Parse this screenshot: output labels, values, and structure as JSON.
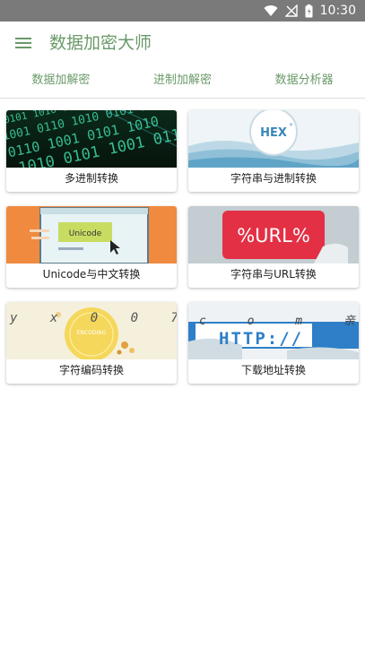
{
  "status_bar": {
    "time": "10:30"
  },
  "app": {
    "title": "数据加密大师"
  },
  "tabs": [
    {
      "label": "数据加解密"
    },
    {
      "label": "进制加解密"
    },
    {
      "label": "数据分析器"
    }
  ],
  "cards": [
    {
      "label": "多进制转换",
      "image_text": "1010 0101 1001"
    },
    {
      "label": "字符串与进制转换",
      "image_text": "HEX"
    },
    {
      "label": "Unicode与中文转换",
      "image_text": "Unicode"
    },
    {
      "label": "字符串与URL转换",
      "image_text": "%URL%"
    },
    {
      "label": "字符编码转换",
      "image_text": "y x 0 0 7 ."
    },
    {
      "label": "下载地址转换",
      "image_text": "HTTP://",
      "image_text2": "c o m 亲 测"
    }
  ],
  "colors": {
    "accent": "#6a9a6a",
    "status_bar": "#7a7a7a"
  }
}
